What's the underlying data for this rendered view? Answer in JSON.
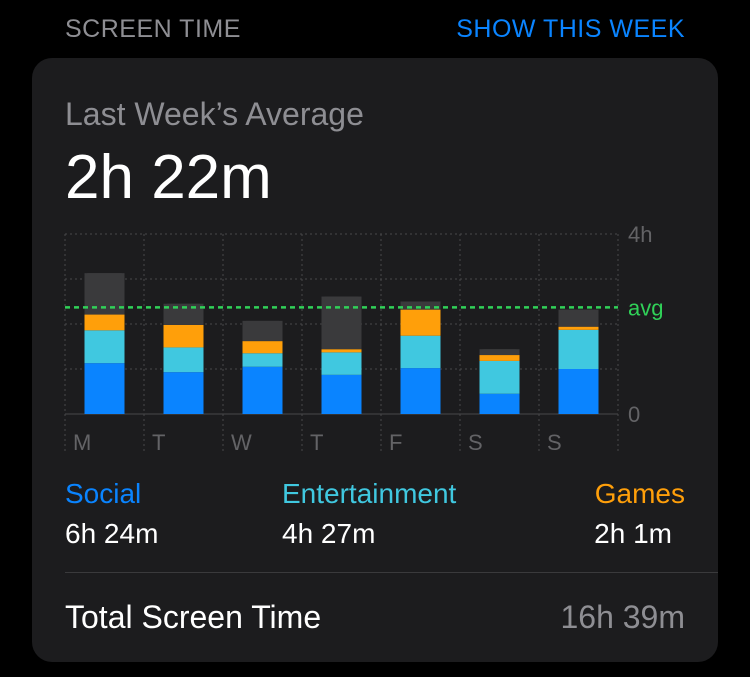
{
  "header": {
    "section_title": "SCREEN TIME",
    "show_week_label": "SHOW THIS WEEK"
  },
  "card": {
    "avg_label": "Last Week’s Average",
    "avg_value": "2h 22m",
    "total_label": "Total Screen Time",
    "total_value": "16h 39m"
  },
  "legend": [
    {
      "name": "Social",
      "value": "6h 24m",
      "color": "#0a84ff"
    },
    {
      "name": "Entertainment",
      "value": "4h 27m",
      "color": "#40c8e0"
    },
    {
      "name": "Games",
      "value": "2h 1m",
      "color": "#ff9f0a"
    }
  ],
  "colors": {
    "other": "#3a3a3c",
    "avg_line": "#30d158",
    "grid": "#48484a",
    "tick": "#636366"
  },
  "chart_data": {
    "type": "bar",
    "stacked": true,
    "categories": [
      "M",
      "T",
      "W",
      "T",
      "F",
      "S",
      "S"
    ],
    "y_ticks": [
      "4h",
      "0"
    ],
    "ylim": [
      0,
      4
    ],
    "avg_label": "avg",
    "avg_value": 2.37,
    "series": [
      {
        "name": "Social",
        "values": [
          1.13,
          0.93,
          1.05,
          0.87,
          1.02,
          0.45,
          1.0
        ]
      },
      {
        "name": "Entertainment",
        "values": [
          0.73,
          0.55,
          0.3,
          0.5,
          0.72,
          0.73,
          0.87
        ]
      },
      {
        "name": "Games",
        "values": [
          0.35,
          0.5,
          0.27,
          0.07,
          0.58,
          0.13,
          0.07
        ]
      },
      {
        "values": [
          0.92,
          0.47,
          0.45,
          1.17,
          0.18,
          0.13,
          0.38
        ]
      }
    ]
  }
}
